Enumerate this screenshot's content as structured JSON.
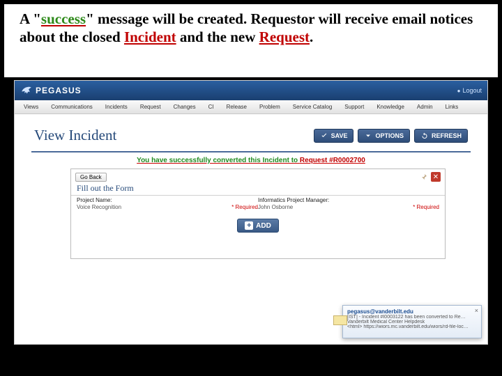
{
  "caption": {
    "pre": "A \"",
    "success": "success",
    "mid1": "\" message will be created. Requestor will receive email notices about the closed ",
    "incident": "Incident",
    "mid2": " and the new ",
    "request": "Request",
    "post": "."
  },
  "app": {
    "brand": "PEGASUS",
    "logout": "Logout",
    "menu": [
      "Views",
      "Communications",
      "Incidents",
      "Request",
      "Changes",
      "CI",
      "Release",
      "Problem",
      "Service Catalog",
      "Support",
      "Knowledge",
      "Admin",
      "Links"
    ],
    "page_title": "View Incident",
    "buttons": {
      "save": "SAVE",
      "options": "OPTIONS",
      "refresh": "REFRESH"
    },
    "flash_pre": "You have successfully converted this Incident to ",
    "flash_req": "Request #R0002700",
    "form": {
      "go_back": "Go Back",
      "title": "Fill out the Form",
      "f1_label": "Project Name:",
      "f1_value": "Voice Recognition",
      "f2_label": "Informatics Project Manager:",
      "f2_value": "John Osborne",
      "required": "Required",
      "add": "ADD"
    }
  },
  "toast": {
    "from": "pegasus@vanderbilt.edu",
    "l1": "[IST] - Incident #I0003122 has been converted to Re…",
    "l2": "Vanderbilt Medical Center Helpdesk",
    "l3": "<html> https://wiors.mc.vanderbilt.edu/wiors/rd-file-loc…"
  }
}
